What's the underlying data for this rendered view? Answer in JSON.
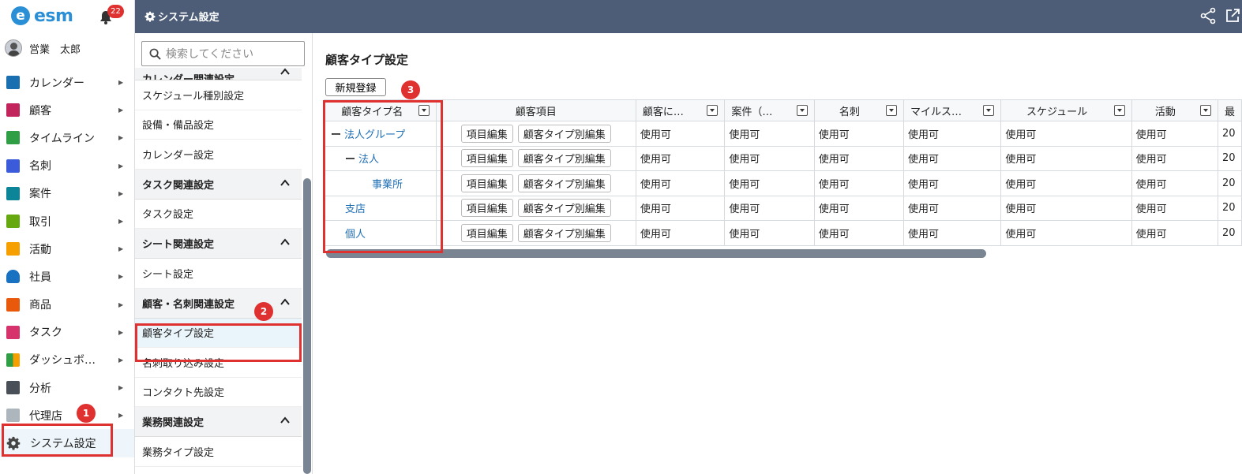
{
  "sidebar": {
    "logo_text": "esm",
    "logo_mark": "e",
    "notification_count": "22",
    "user_name": "営業　太郎",
    "items": [
      {
        "label": "カレンダー",
        "icon": "calendar-icon",
        "color": "#1a6fb0"
      },
      {
        "label": "顧客",
        "icon": "customer-icon",
        "color": "#c2255c"
      },
      {
        "label": "タイムライン",
        "icon": "timeline-icon",
        "color": "#2f9e44"
      },
      {
        "label": "名刺",
        "icon": "business-card-icon",
        "color": "#3b5bdb"
      },
      {
        "label": "案件",
        "icon": "deal-icon",
        "color": "#0c8599"
      },
      {
        "label": "取引",
        "icon": "transaction-icon",
        "color": "#66a80f"
      },
      {
        "label": "活動",
        "icon": "activity-icon",
        "color": "#f59f00"
      },
      {
        "label": "社員",
        "icon": "employee-icon",
        "color": "#1971c2"
      },
      {
        "label": "商品",
        "icon": "product-icon",
        "color": "#e8590c"
      },
      {
        "label": "タスク",
        "icon": "task-icon",
        "color": "#d6336c"
      },
      {
        "label": "ダッシュボ…",
        "icon": "dashboard-icon",
        "color": "#2f9e44"
      },
      {
        "label": "分析",
        "icon": "analysis-icon",
        "color": "#495057"
      },
      {
        "label": "代理店",
        "icon": "agency-icon",
        "color": "#adb5bd"
      }
    ],
    "active_item": {
      "label": "システム設定",
      "icon": "gear-icon"
    }
  },
  "topbar": {
    "title": "システム設定"
  },
  "settings_nav": {
    "search_placeholder": "検索してください",
    "cut_header": "カレンダー関連設定",
    "groups": [
      {
        "items": [
          "スケジュール種別設定",
          "設備・備品設定",
          "カレンダー設定"
        ]
      },
      {
        "header": "タスク関連設定",
        "items": [
          "タスク設定"
        ]
      },
      {
        "header": "シート関連設定",
        "items": [
          "シート設定"
        ]
      },
      {
        "header": "顧客・名刺関連設定",
        "items": [
          "顧客タイプ設定",
          "名刺取り込み設定",
          "コンタクト先設定"
        ]
      },
      {
        "header": "業務関連設定",
        "items": [
          "業務タイプ設定"
        ]
      }
    ]
  },
  "main": {
    "page_title": "顧客タイプ設定",
    "new_button": "新規登録",
    "columns": [
      "顧客タイプ名",
      "顧客項目",
      "顧客に…",
      "案件（…",
      "名刺",
      "マイルス…",
      "スケジュール",
      "活動",
      "最"
    ],
    "item_edit": "項目編集",
    "type_edit": "顧客タイプ別編集",
    "rows": [
      {
        "name": "法人グループ",
        "prefix": "ー",
        "cells": [
          "使用可",
          "使用可",
          "使用可",
          "使用可",
          "使用可",
          "使用可",
          "20"
        ]
      },
      {
        "name": "法人",
        "prefix": "ー",
        "cells": [
          "使用可",
          "使用可",
          "使用可",
          "使用可",
          "使用可",
          "使用可",
          "20"
        ]
      },
      {
        "name": "事業所",
        "prefix": "",
        "cells": [
          "使用可",
          "使用可",
          "使用可",
          "使用可",
          "使用可",
          "使用可",
          "20"
        ]
      },
      {
        "name": "支店",
        "prefix": "",
        "cells": [
          "使用可",
          "使用可",
          "使用可",
          "使用可",
          "使用可",
          "使用可",
          "20"
        ]
      },
      {
        "name": "個人",
        "prefix": "",
        "cells": [
          "使用可",
          "使用可",
          "使用可",
          "使用可",
          "使用可",
          "使用可",
          "20"
        ]
      }
    ]
  },
  "callouts": [
    "1",
    "2",
    "3"
  ]
}
